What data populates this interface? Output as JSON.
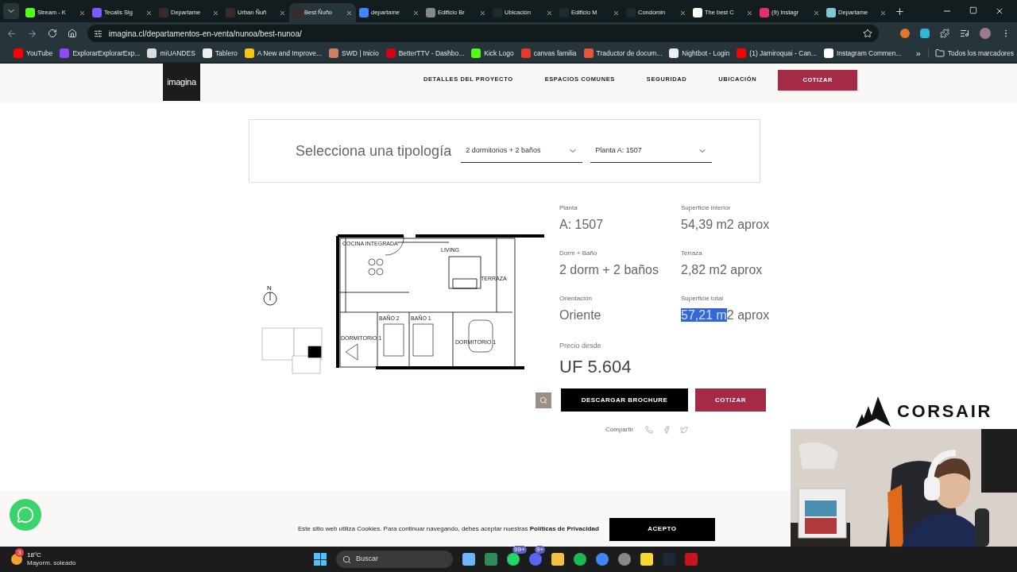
{
  "tabs": [
    {
      "title": "Stream - K",
      "color": "#53fc18",
      "selected": false
    },
    {
      "title": "Tecalis Sig",
      "color": "#7b5cff",
      "selected": false
    },
    {
      "title": "Departame",
      "color": "#3a2a2a",
      "selected": false
    },
    {
      "title": "Urban Ñuñ",
      "color": "#3a2a2a",
      "selected": false
    },
    {
      "title": "Best Ñuño",
      "color": "#3a2a2a",
      "selected": true
    },
    {
      "title": "departame",
      "color": "#4285f4",
      "selected": false
    },
    {
      "title": "Edificio Br",
      "color": "#888888",
      "selected": false
    },
    {
      "title": "Ubicación",
      "color": "#1f2a2e",
      "selected": false
    },
    {
      "title": "Edificio M",
      "color": "#1f2a2e",
      "selected": false
    },
    {
      "title": "Condomin",
      "color": "#1f2a2e",
      "selected": false
    },
    {
      "title": "The best C",
      "color": "#ffffff",
      "selected": false
    },
    {
      "title": "(9) Instagr",
      "color": "#e1306c",
      "selected": false
    },
    {
      "title": "Departame",
      "color": "#7fc8d8",
      "selected": false
    }
  ],
  "address": "imagina.cl/departamentos-en-venta/nunoa/best-nunoa/",
  "bookmarks": [
    {
      "label": "YouTube",
      "color": "#ff0000"
    },
    {
      "label": "ExplorarExplorarExp...",
      "color": "#9146ff"
    },
    {
      "label": "miUANDES",
      "color": "#dddddd"
    },
    {
      "label": "Tablero",
      "color": "#eeeeee"
    },
    {
      "label": "A New and Improve...",
      "color": "#f5c518"
    },
    {
      "label": "SWD | Inicio",
      "color": "#d08060"
    },
    {
      "label": "BetterTTV - Dashbo...",
      "color": "#d50014"
    },
    {
      "label": "Kick Logo",
      "color": "#53fc18"
    },
    {
      "label": "canvas familia",
      "color": "#e23a2e"
    },
    {
      "label": "Traductor de docum...",
      "color": "#e8553a"
    },
    {
      "label": "Nightbot - Login",
      "color": "#eeeeee"
    },
    {
      "label": "(1) Jamiroquai - Can...",
      "color": "#ff0000"
    },
    {
      "label": "Instagram Commen...",
      "color": "#ffffff"
    }
  ],
  "bookmarks_more": "»",
  "all_bookmarks": "Todos los marcadores",
  "site": {
    "logo": "imagina",
    "nav": [
      "DETALLES DEL PROYECTO",
      "ESPACIOS COMUNES",
      "SEGURIDAD",
      "UBICACIÓN"
    ],
    "nav_button": "COTIZAR",
    "selector": {
      "title": "Selecciona una tipología",
      "dropdowns": [
        "2 dormitorios + 2 baños",
        "Planta A: 1507"
      ]
    },
    "floor_plan": {
      "north": "N",
      "rooms": [
        "COCINA INTEGRADA",
        "LIVING",
        "TERRAZA",
        "BAÑO 2",
        "BAÑO 1",
        "DORMITORIO 1",
        "DORMITORIO 1"
      ]
    },
    "details": [
      {
        "label": "Planta",
        "value_parts": [
          {
            "text": "A: 1507",
            "selected": false
          }
        ]
      },
      {
        "label": "Superficie interior",
        "value_parts": [
          {
            "text": "54,39 m2 aprox",
            "selected": false
          }
        ]
      },
      {
        "label": "Dorm + Baño",
        "value_parts": [
          {
            "text": "2 dorm + 2 baños",
            "selected": false
          }
        ]
      },
      {
        "label": "Terraza",
        "value_parts": [
          {
            "text": "2,82 m2 aprox",
            "selected": false
          }
        ]
      },
      {
        "label": "Orientación",
        "value_parts": [
          {
            "text": "Oriente",
            "selected": false
          }
        ]
      },
      {
        "label": "Superficie total",
        "value_parts": [
          {
            "text": "57,21 m",
            "selected": true
          },
          {
            "text": "2 aprox",
            "selected": false
          }
        ]
      }
    ],
    "price_label": "Precio desde",
    "price": "UF 5.604",
    "brochure_button": "DESCARGAR BROCHURE",
    "quote_button": "COTIZAR",
    "share_label": "Compartir",
    "cookie": {
      "text_before": "Este sitio web utiliza Cookies. Para continuar navegando, debes aceptar nuestras ",
      "link": "Políticas de Privacidad",
      "button": "ACEPTO"
    }
  },
  "overlay": {
    "brand": "CORSAIR"
  },
  "taskbar": {
    "temperature": "18°C",
    "weather": "Mayorm. soleado",
    "weather_badge": "3",
    "search": "Buscar",
    "apps": [
      {
        "kind": "notes",
        "color": "#6cb6ff"
      },
      {
        "kind": "sheet",
        "color": "#2e8b57"
      },
      {
        "kind": "chat",
        "color": "#25d366",
        "badge": "99+"
      },
      {
        "kind": "chat",
        "color": "#5865f2",
        "badge": "9+"
      },
      {
        "kind": "folder",
        "color": "#f4c142"
      },
      {
        "kind": "music",
        "color": "#1db954"
      },
      {
        "kind": "browser",
        "color": "#4285f4"
      },
      {
        "kind": "browser",
        "color": "#888888"
      },
      {
        "kind": "note",
        "color": "#f7d731"
      },
      {
        "kind": "game",
        "color": "#1b2838"
      },
      {
        "kind": "pdf",
        "color": "#c4161c"
      }
    ]
  }
}
